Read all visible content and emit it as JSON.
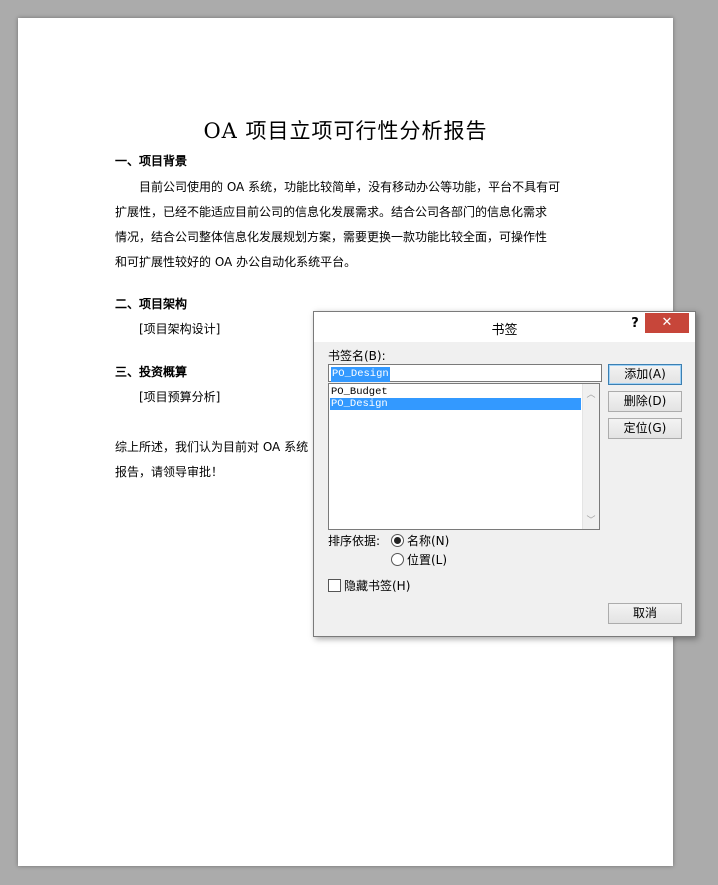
{
  "document": {
    "title": "OA 项目立项可行性分析报告",
    "section1_heading": "一、项目背景",
    "section1_lines": [
      "目前公司使用的 OA 系统，功能比较简单，没有移动办公等功能，平台不具有可",
      "扩展性，已经不能适应目前公司的信息化发展需求。结合公司各部门的信息化需求",
      "情况，结合公司整体信息化发展规划方案，需要更换一款功能比较全面，可操作性",
      "和可扩展性较好的 OA 办公自动化系统平台。"
    ],
    "section2_heading": "二、项目架构",
    "section2_body": "[项目架构设计]",
    "section3_heading": "三、投资概算",
    "section3_body": "[项目预算分析]",
    "conclusion_lines": [
      "综上所述，我们认为目前对 OA 系统",
      "报告，请领导审批！"
    ]
  },
  "dialog": {
    "title": "书签",
    "help": "?",
    "close": "✕",
    "name_label": "书签名(B):",
    "name_value": "PO_Design",
    "bookmarks": [
      "PO_Budget",
      "PO_Design"
    ],
    "selected_bookmark": "PO_Design",
    "buttons": {
      "add": "添加(A)",
      "delete": "删除(D)",
      "goto": "定位(G)",
      "cancel": "取消"
    },
    "sort_label": "排序依据:",
    "sort_options": [
      "名称(N)",
      "位置(L)"
    ],
    "sort_selected": "名称(N)",
    "hidden_label": "隐藏书签(H)",
    "hidden_checked": false
  }
}
